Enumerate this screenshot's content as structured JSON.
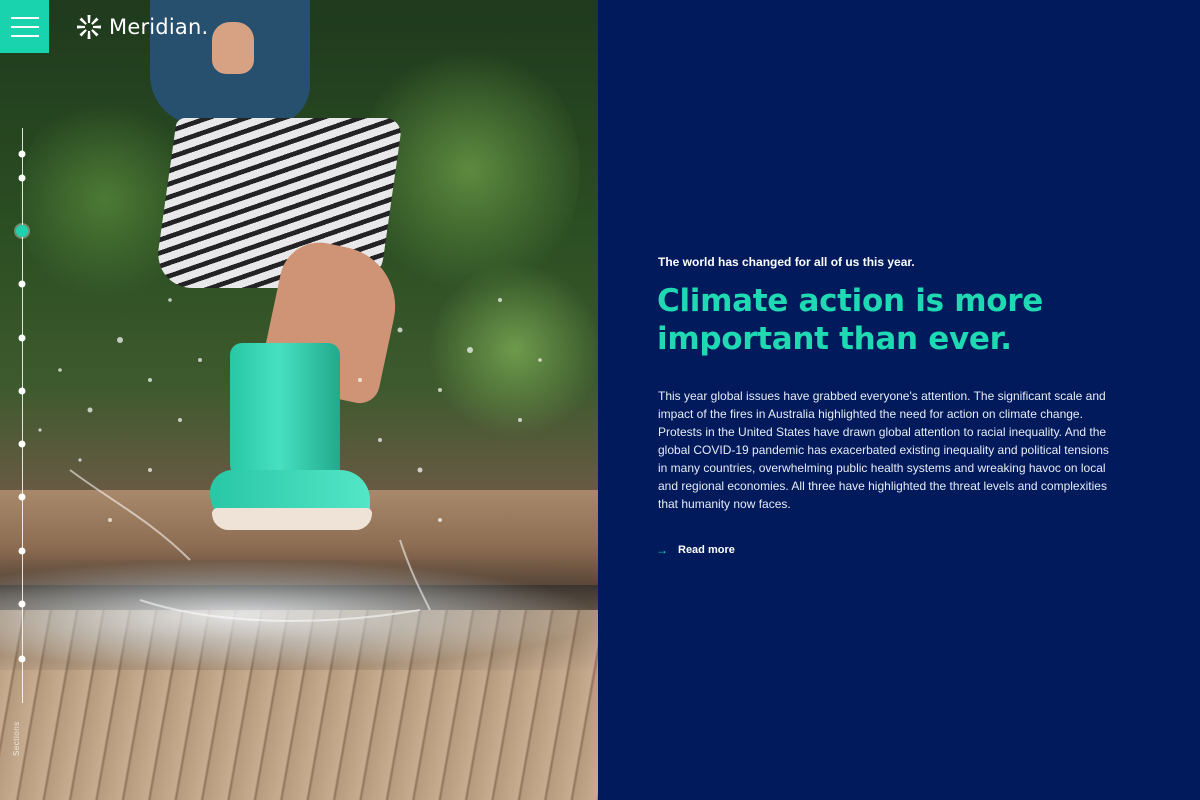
{
  "brand": {
    "name": "Meridian.",
    "accent_color": "#1fd9b2",
    "background_color": "#001a5c"
  },
  "header": {
    "menu_icon": "hamburger-icon",
    "logo_icon": "sunburst-logo-icon"
  },
  "section_nav": {
    "label": "Sections",
    "dot_count": 11,
    "active_index": 2
  },
  "hero": {
    "image_description_icon": "photo-child-splashing-puddle",
    "eyebrow": "The world has changed for all of us this year.",
    "headline": "Climate action is more important than ever.",
    "body": "This year global issues have grabbed everyone's attention. The significant scale and impact of the fires in Australia highlighted the need for action on climate change. Protests in the United States have drawn global attention to racial inequality. And the global COVID-19 pandemic has exacerbated existing inequality and political tensions in many countries, overwhelming public health systems and wreaking havoc on local and regional economies. All three have highlighted the threat levels and complexities that humanity now faces.",
    "read_more_label": "Read more",
    "read_more_icon": "arrow-right-icon"
  }
}
